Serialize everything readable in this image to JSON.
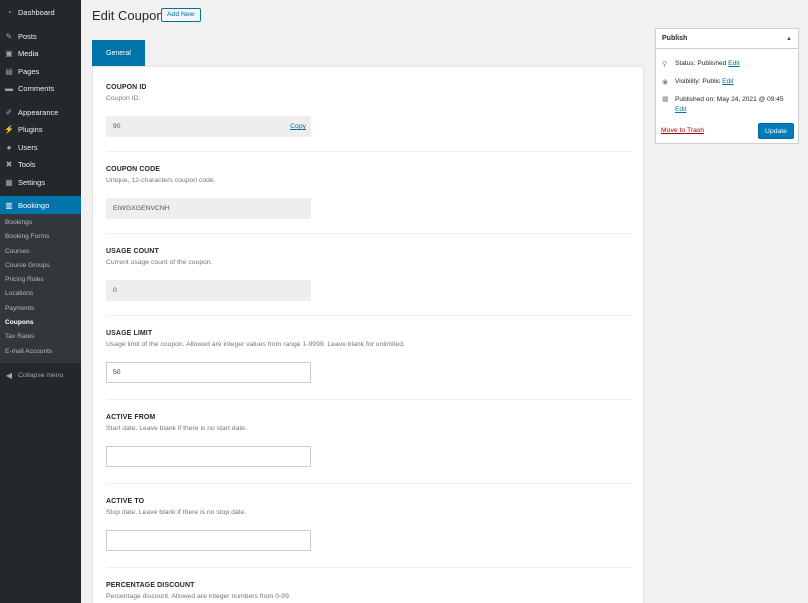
{
  "sidebar": {
    "top_items": [
      {
        "label": "Dashboard",
        "icon": "dashboard-icon"
      },
      {
        "label": "Posts",
        "icon": "pin-icon"
      },
      {
        "label": "Media",
        "icon": "media-icon"
      },
      {
        "label": "Pages",
        "icon": "pages-icon"
      },
      {
        "label": "Comments",
        "icon": "comments-icon"
      }
    ],
    "mid_items": [
      {
        "label": "Appearance",
        "icon": "brush-icon"
      },
      {
        "label": "Plugins",
        "icon": "plug-icon"
      },
      {
        "label": "Users",
        "icon": "users-icon"
      },
      {
        "label": "Tools",
        "icon": "wrench-icon"
      },
      {
        "label": "Settings",
        "icon": "settings-icon"
      }
    ],
    "active": {
      "label": "Bookingo",
      "icon": "calendar-icon"
    },
    "submenu": [
      "Bookings",
      "Booking Forms",
      "Courses",
      "Course Groups",
      "Pricing Rules",
      "Locations",
      "Payments",
      "Coupons",
      "Tax Rates",
      "E-mail Accounts"
    ],
    "current_sub": "Coupons",
    "collapse_label": "Collapse menu"
  },
  "header": {
    "title": "Edit Coupon",
    "add_new": "Add New"
  },
  "tab": {
    "label": "General"
  },
  "fields": {
    "coupon_id": {
      "label": "COUPON ID",
      "desc": "Coupon ID.",
      "value": "90",
      "copy": "Copy"
    },
    "coupon_code": {
      "label": "COUPON CODE",
      "desc": "Unique, 12-characters coupon code.",
      "value": "EIWGXGENVCNH"
    },
    "usage_count": {
      "label": "USAGE COUNT",
      "desc": "Current usage count of the coupon.",
      "value": "0"
    },
    "usage_limit": {
      "label": "USAGE LIMIT",
      "desc": "Usage limit of the coupon. Allowed are integer values from range 1-9999. Leave blank for unlimited.",
      "value": "50"
    },
    "active_from": {
      "label": "ACTIVE FROM",
      "desc": "Start date. Leave blank if there is no start date.",
      "value": ""
    },
    "active_to": {
      "label": "ACTIVE TO",
      "desc": "Stop date. Leave blank if there is no stop date.",
      "value": ""
    },
    "percentage_discount": {
      "label": "PERCENTAGE DISCOUNT",
      "desc": "Percentage discount. Allowed are integer numbers from 0-99."
    }
  },
  "publish": {
    "title": "Publish",
    "status_label": "Status: Published",
    "visibility_label": "Visibility: Public",
    "published_on": "Published on: May 24, 2021 @ 09:45",
    "edit": "Edit",
    "trash": "Move to Trash",
    "update": "Update"
  },
  "colors": {
    "accent": "#0073aa",
    "sidebar": "#23282d",
    "trash": "#aa0000"
  }
}
